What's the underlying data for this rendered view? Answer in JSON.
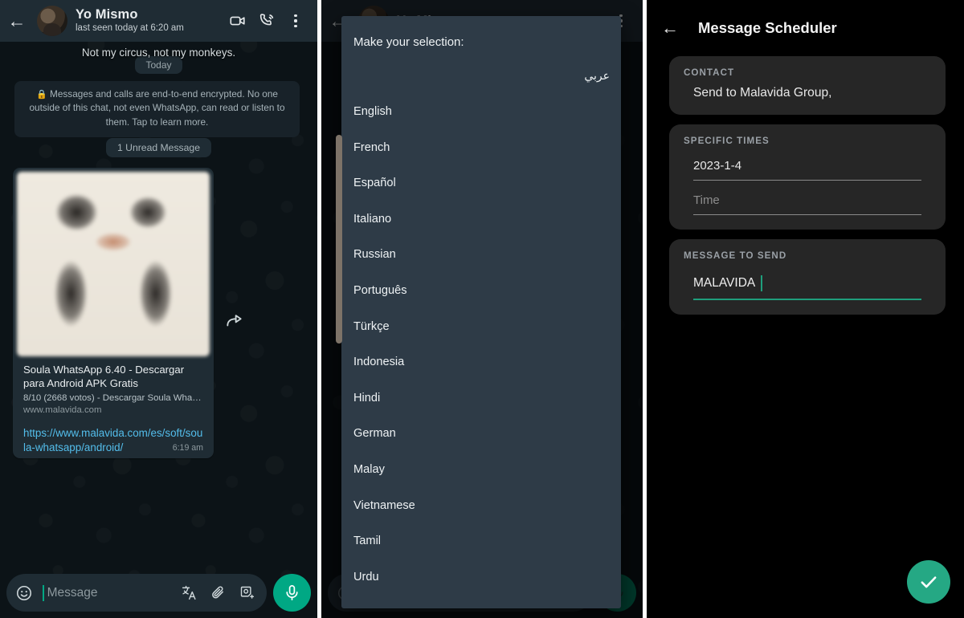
{
  "chat_panel": {
    "header": {
      "back_icon": "back-arrow-icon",
      "contact_name": "Yo Mismo",
      "status": "last seen today at 6:20 am",
      "video_call_icon": "video-call-icon",
      "voice_call_icon": "voice-call-icon",
      "overflow_icon": "more-vertical-icon"
    },
    "status_line": "Not my circus, not my monkeys.",
    "day_divider": "Today",
    "encryption_notice": "Messages and calls are end-to-end encrypted. No one outside of this chat, not even WhatsApp, can read or listen to them. Tap to learn more.",
    "lock_icon": "lock-icon",
    "unread_divider": "1 Unread Message",
    "link_preview": {
      "image": "blurred-preview-thumbnail",
      "title": "Soula WhatsApp 6.40 - Descargar para Android APK Gratis",
      "description": "8/10 (2668 votos) - Descargar Soula WhatsA…",
      "host": "www.malavida.com",
      "url": "https://www.malavida.com/es/soft/soula-whatsapp/android/",
      "time": "6:19 am",
      "forward_icon": "forward-icon"
    },
    "composer": {
      "emoji_icon": "emoji-icon",
      "placeholder": "Message",
      "translate_icon": "translate-icon",
      "attach_icon": "attachment-clip-icon",
      "sticker_icon": "sticker-add-icon",
      "mic_icon": "microphone-icon"
    }
  },
  "language_panel": {
    "ghost_contact_name": "Yo Mismo",
    "dialog": {
      "title": "Make your selection:",
      "rtl_option": "عربي",
      "options": [
        "English",
        "French",
        "Español",
        "Italiano",
        "Russian",
        "Português",
        "Türkçe",
        "Indonesia",
        "Hindi",
        "German",
        "Malay",
        "Vietnamese",
        "Tamil",
        "Urdu"
      ]
    }
  },
  "scheduler_panel": {
    "header": {
      "back_icon": "back-arrow-icon",
      "title": "Message Scheduler"
    },
    "contact_card": {
      "label": "CONTACT",
      "value": "Send to Malavida Group,"
    },
    "times_card": {
      "label": "SPECIFIC TIMES",
      "date_value": "2023-1-4",
      "time_placeholder": "Time"
    },
    "message_card": {
      "label": "MESSAGE TO SEND",
      "value": "MALAVIDA"
    },
    "confirm_button": {
      "icon": "check-icon"
    }
  },
  "colors": {
    "whatsapp_green": "#00a884",
    "accent_teal": "#25a884",
    "header_bar": "#1f2c34",
    "chat_background": "#0c1317",
    "bubble": "#1f2c34",
    "link_blue": "#53bdeb",
    "dialog_background": "#2e3b47",
    "card_background": "#262626",
    "scheduler_background": "#000000"
  }
}
